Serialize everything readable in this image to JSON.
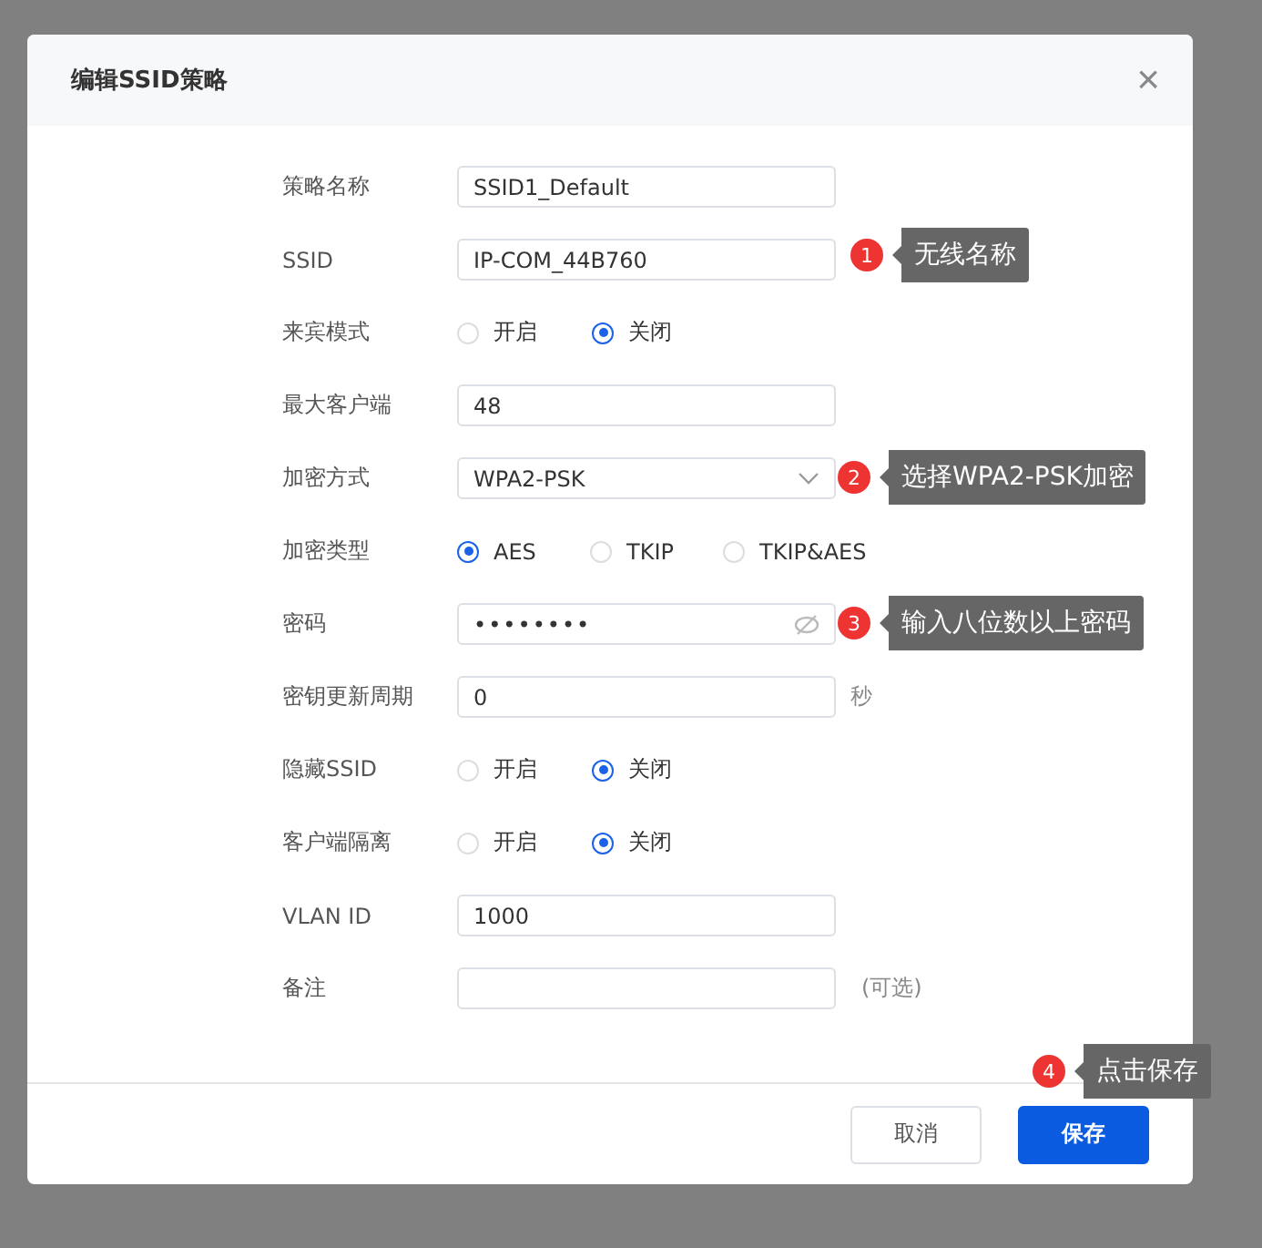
{
  "dialog": {
    "title": "编辑SSID策略",
    "close_icon": "×"
  },
  "rows": [
    {
      "kind": "text",
      "label": "策略名称",
      "value": "SSID1_Default"
    },
    {
      "kind": "text",
      "label": "SSID",
      "value": "IP-COM_44B760",
      "note": {
        "number": "1",
        "text": "无线名称"
      }
    },
    {
      "kind": "radio",
      "label": "来宾模式",
      "options": [
        {
          "label": "开启",
          "selected": false
        },
        {
          "label": "关闭",
          "selected": true
        }
      ]
    },
    {
      "kind": "text",
      "label": "最大客户端",
      "value": "48"
    },
    {
      "kind": "select",
      "label": "加密方式",
      "value": "WPA2-PSK",
      "note": {
        "number": "2",
        "text": "选择WPA2-PSK加密"
      }
    },
    {
      "kind": "radio",
      "label": "加密类型",
      "options": [
        {
          "label": "AES",
          "selected": true
        },
        {
          "label": "TKIP",
          "selected": false
        },
        {
          "label": "TKIP&AES",
          "selected": false
        }
      ]
    },
    {
      "kind": "password",
      "label": "密码",
      "value": "••••••••",
      "note": {
        "number": "3",
        "text": "输入八位数以上密码"
      }
    },
    {
      "kind": "text",
      "label": "密钥更新周期",
      "value": "0",
      "suffix": "秒"
    },
    {
      "kind": "radio",
      "label": "隐藏SSID",
      "options": [
        {
          "label": "开启",
          "selected": false
        },
        {
          "label": "关闭",
          "selected": true
        }
      ]
    },
    {
      "kind": "radio",
      "label": "客户端隔离",
      "options": [
        {
          "label": "开启",
          "selected": false
        },
        {
          "label": "关闭",
          "selected": true
        }
      ]
    },
    {
      "kind": "text",
      "label": "VLAN ID",
      "value": "1000"
    },
    {
      "kind": "text",
      "label": "备注",
      "value": "",
      "suffix": "(可选)"
    }
  ],
  "footer": {
    "note": {
      "number": "4",
      "text": "点击保存"
    },
    "buttons": [
      {
        "label": "取消",
        "kind": "secondary"
      },
      {
        "label": "保存",
        "kind": "primary"
      }
    ]
  }
}
